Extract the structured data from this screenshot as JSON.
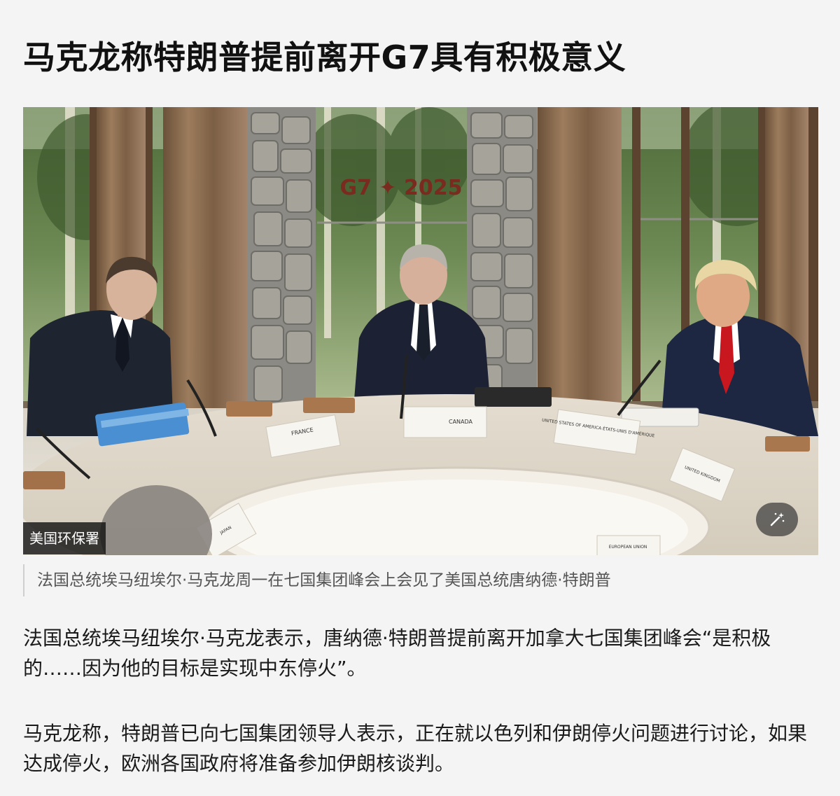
{
  "article": {
    "headline": "马克龙称特朗普提前离开G7具有积极意义",
    "photo": {
      "credit": "美国环保署",
      "banner_text": "G7 ✦ 2025",
      "placards": [
        "FRANCE",
        "CANADA",
        "UNITED STATES OF AMERICA ÉTATS-UNIS D'AMÉRIQUE",
        "UNITED KINGDOM",
        "JAPAN",
        "EUROPEAN UNION"
      ],
      "tool_icon": "magic-wand-icon"
    },
    "caption": "法国总统埃马纽埃尔·马克龙周一在七国集团峰会上会见了美国总统唐纳德·特朗普",
    "paragraphs": [
      "法国总统埃马纽埃尔·马克龙表示，唐纳德·特朗普提前离开加拿大七国集团峰会“是积极的……因为他的目标是实现中东停火”。",
      "马克龙称，特朗普已向七国集团领导人表示，正在就以色列和伊朗停火问题进行讨论，如果达成停火，欧洲各国政府将准备参加伊朗核谈判。"
    ]
  },
  "colors": {
    "background": "#f4f4f4",
    "text": "#1a1a1a",
    "caption_text": "#555555",
    "banner_red": "#7a2b20"
  }
}
